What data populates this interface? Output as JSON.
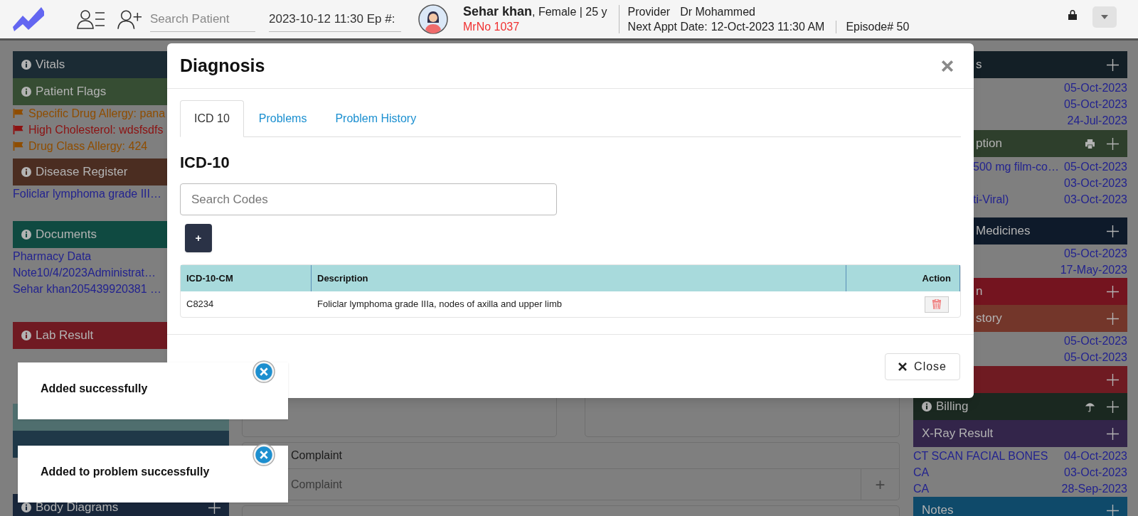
{
  "top_bar": {
    "search": {
      "placeholder": "Search Patient"
    },
    "episode_field": {
      "value": "2023-10-12 11:30 Ep #:"
    },
    "patient": {
      "name": "Sehar khan",
      "details": ", Female | 25 y",
      "mrno": "MrNo 1037"
    },
    "provider": {
      "label": "Provider",
      "value": "Dr Mohammed"
    },
    "next_appointment": {
      "label": "Next Appt Date:",
      "value": "12-Oct-2023 11:30 AM"
    },
    "episode": "Episode# 50"
  },
  "left_panels": [
    {
      "title": "Vitals",
      "color": "#1b2b34",
      "info": true,
      "add": false
    },
    {
      "title": "Patient Flags",
      "color": "#364d33",
      "info": true,
      "add": false,
      "items": [
        {
          "kind": "flag",
          "text": "Specific Drug Allergy: pana",
          "color": "#8f4d00"
        },
        {
          "kind": "flag",
          "text": "High Cholesterol: wdsfsdfs",
          "color": "#8c1212"
        },
        {
          "kind": "flag",
          "text": "Drug Class Allergy: 424",
          "color": "#8f4d00"
        }
      ]
    },
    {
      "title": "Disease Register",
      "color": "#4b2d21",
      "info": true,
      "add": false,
      "items": [
        {
          "kind": "link",
          "text": "Foliclar lymphoma grade III…"
        }
      ]
    },
    {
      "title": "Documents",
      "color": "#0f4a41",
      "info": true,
      "add": false,
      "items": [
        {
          "kind": "link",
          "text": "Pharmacy Data"
        },
        {
          "kind": "link",
          "text": "Note10/4/2023Administrat…"
        },
        {
          "kind": "link",
          "text": "Sehar khan205439920381 …"
        }
      ]
    },
    {
      "title": "Lab Result",
      "color": "#701a22",
      "info": true,
      "add": false
    },
    {
      "color": "#4f6e6e"
    },
    {
      "color": "#1f3848"
    },
    {
      "title": "Body Diagrams",
      "color": "#18263a",
      "info": true,
      "add": true
    }
  ],
  "middle": {
    "complaint": {
      "title": "Complaint",
      "input": {
        "placeholder": "Complaint"
      },
      "add_button": "+"
    }
  },
  "right_panels": [
    {
      "title": "s",
      "color": "#131f26",
      "info": false,
      "add": true,
      "rows": [
        {
          "date": "05-Oct-2023"
        },
        {
          "date": "05-Oct-2023"
        },
        {
          "date": "24-Jul-2023"
        }
      ]
    },
    {
      "title": "ption",
      "color": "#2e3f2c",
      "info": false,
      "add": true,
      "rows": [
        {
          "text": "500 mg film-co…",
          "date": "05-Oct-2023"
        },
        {
          "date": "03-Oct-2023"
        },
        {
          "text": "ti-Viral)",
          "date": "03-Oct-2023"
        }
      ]
    },
    {
      "title": "Medicines",
      "color": "#0e1a2a",
      "info": false,
      "add": true,
      "rows": [
        {
          "date": "05-Oct-2023"
        },
        {
          "date": "17-May-2023"
        }
      ]
    },
    {
      "title": "n",
      "color": "#74141f",
      "info": false,
      "add": true
    },
    {
      "title": "story",
      "color": "#73362a",
      "info": false,
      "add": true,
      "rows": [
        {
          "date": "05-Oct-2023"
        },
        {
          "date": "05-Oct-2023"
        }
      ]
    },
    {
      "color": "#6f1b22",
      "info": false,
      "add": true
    },
    {
      "title": "Billing",
      "color": "#1a2820",
      "info": true,
      "add": true
    },
    {
      "title": "X-Ray Result",
      "color": "#33254a",
      "info": false,
      "add": true,
      "rows": [
        {
          "text": "CT SCAN FACIAL BONES",
          "date": "04-Oct-2023"
        },
        {
          "text": "CA",
          "date": "03-Oct-2023"
        },
        {
          "text": "CA",
          "date": "28-Sep-2023"
        }
      ]
    },
    {
      "title": "Notes",
      "color": "#0f4a6a",
      "info": false,
      "add": true
    }
  ],
  "modal": {
    "title": "Diagnosis",
    "tabs": [
      {
        "label": "ICD 10",
        "selected": true
      },
      {
        "label": "Problems",
        "selected": false
      },
      {
        "label": "Problem History",
        "selected": false
      }
    ],
    "section_title": "ICD-10",
    "search": {
      "placeholder": "Search Codes"
    },
    "add_button": "+",
    "table": {
      "columns": [
        "ICD-10-CM",
        "Description",
        "Action"
      ],
      "rows": [
        {
          "cells": [
            "C8234",
            "Foliclar lymphoma grade IIIa, nodes of axilla and upper limb"
          ]
        }
      ]
    },
    "close_button": "Close"
  },
  "toasts": [
    {
      "message": "Added successfully"
    },
    {
      "message": "Added to problem successfully"
    }
  ]
}
